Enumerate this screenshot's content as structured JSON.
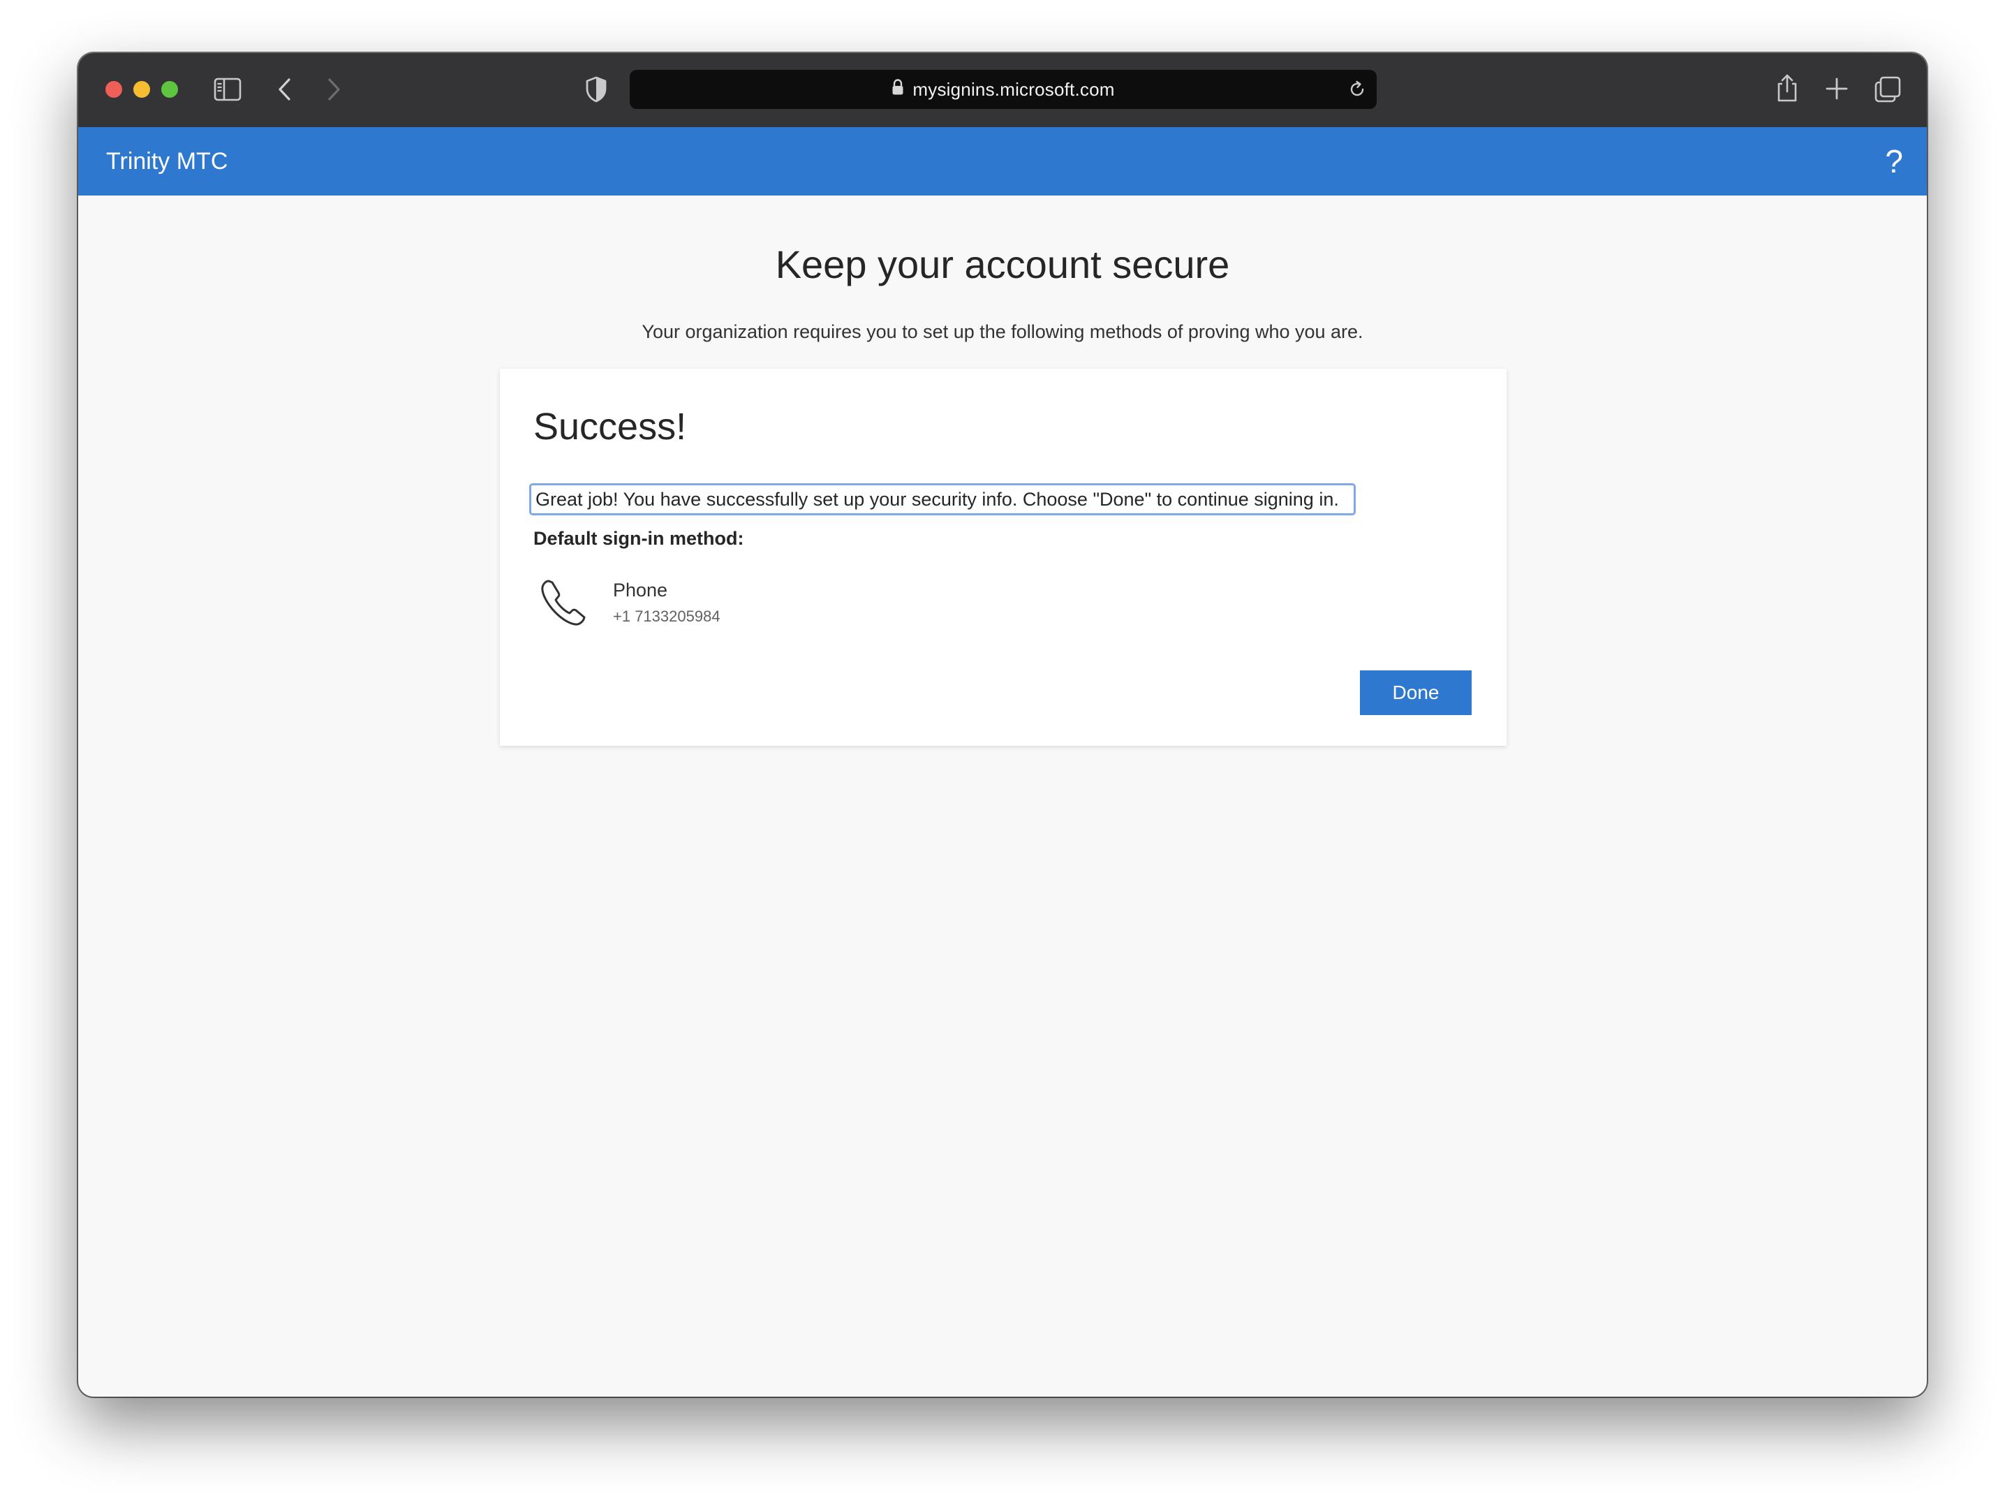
{
  "browser": {
    "url": "mysignins.microsoft.com",
    "icons": {
      "sidebar": "sidebar-icon",
      "back": "chevron-left-icon",
      "forward": "chevron-right-icon",
      "privacy": "shield-icon",
      "lock": "lock-icon",
      "reload": "reload-icon",
      "share": "share-icon",
      "new_tab": "plus-icon",
      "tabs": "tabs-overview-icon"
    }
  },
  "header": {
    "org_name": "Trinity MTC",
    "help": "?",
    "color": "#2f78cf"
  },
  "main": {
    "title": "Keep your account secure",
    "subtitle": "Your organization requires you to set up the following methods of proving who you are."
  },
  "card": {
    "title": "Success!",
    "message": "Great job! You have successfully set up your security info. Choose \"Done\" to continue signing in.",
    "default_label": "Default sign-in method:",
    "method": {
      "icon": "phone-icon",
      "name": "Phone",
      "value": "+1 7133205984"
    },
    "done_label": "Done"
  }
}
